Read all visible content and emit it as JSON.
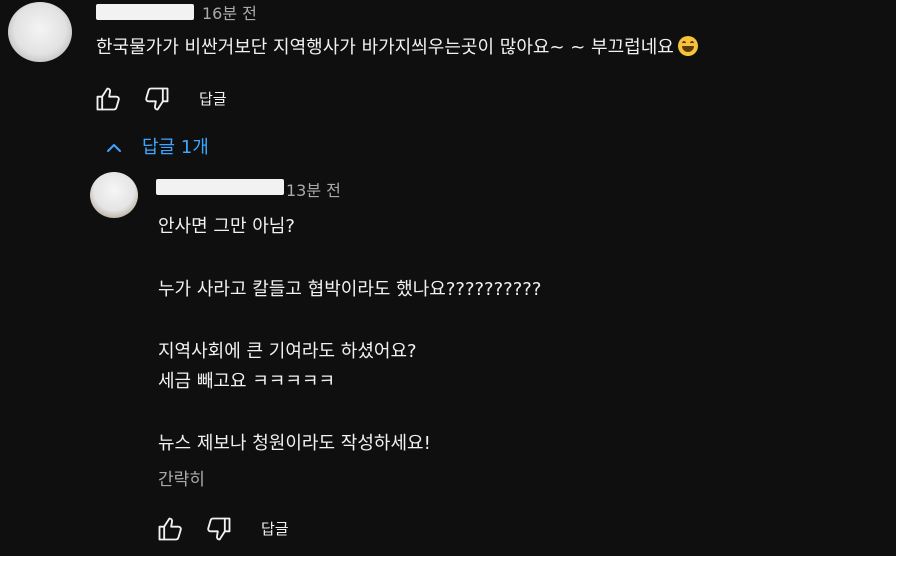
{
  "top_comment": {
    "timestamp": "16분 전",
    "text": "한국물가가 비싼거보단 지역행사가 바가지씌우는곳이 많아요~ ~ 부끄럽네요",
    "emoji": "grinning-sweat-emoji",
    "reply_label": "답글"
  },
  "replies_toggle": {
    "label": "답글 1개",
    "icon": "chevron-up-icon",
    "color": "#3ea6ff"
  },
  "reply": {
    "timestamp": "13분 전",
    "lines": [
      "안사면 그만 아님?",
      "누가 사라고 칼들고 협박이라도 했나요??????????",
      "지역사회에 큰 기여라도 하셨어요?",
      "세금 빼고요 ㅋㅋㅋㅋㅋ",
      "뉴스 제보나 청원이라도 작성하세요!"
    ],
    "read_less": "간략히",
    "reply_label": "답글"
  },
  "icons": {
    "like": "thumbs-up-icon",
    "dislike": "thumbs-down-icon"
  },
  "colors": {
    "background": "#0f0f0f",
    "text": "#f1f1f1",
    "secondary_text": "#aaaaaa",
    "link": "#3ea6ff"
  }
}
